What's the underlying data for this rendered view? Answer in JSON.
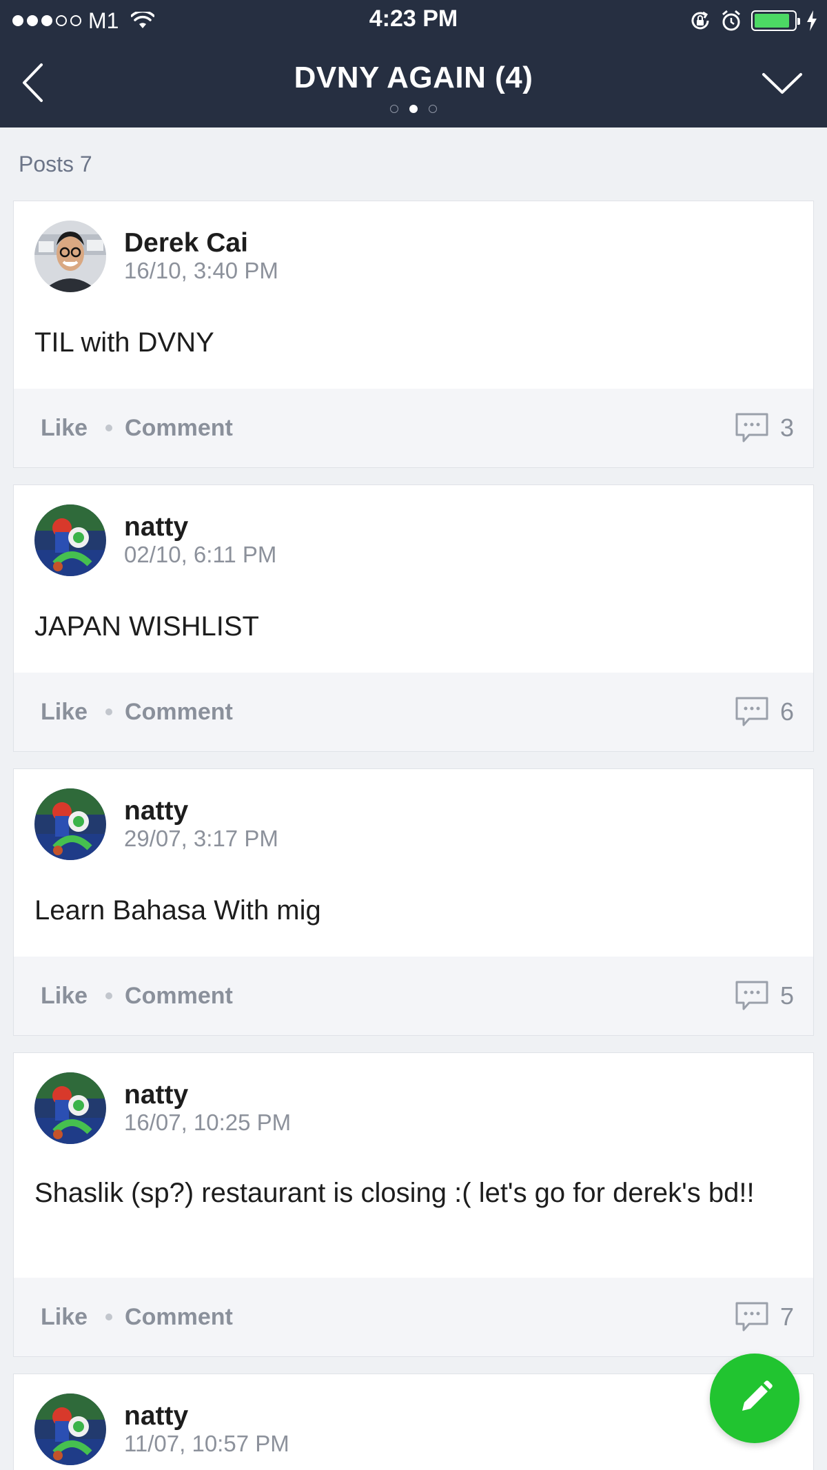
{
  "status_bar": {
    "carrier": "M1",
    "time": "4:23 PM",
    "signal_filled": 3,
    "signal_total": 5,
    "battery_level": 0.9,
    "battery_color": "#4cd964"
  },
  "nav": {
    "title": "DVNY AGAIN (4)",
    "back_icon": "chevron-left-icon",
    "menu_icon": "chevron-down-icon",
    "page_dots_total": 3,
    "page_dots_active": 2
  },
  "posts_count_label": "Posts 7",
  "like_label": "Like",
  "comment_label": "Comment",
  "posts": [
    {
      "author": "Derek Cai",
      "time": "16/10, 3:40 PM",
      "text": "TIL with DVNY",
      "comments": "3"
    },
    {
      "author": "natty",
      "time": "02/10, 6:11 PM",
      "text": "JAPAN WISHLIST",
      "comments": "6"
    },
    {
      "author": "natty",
      "time": "29/07, 3:17 PM",
      "text": "Learn Bahasa With mig",
      "comments": "5"
    },
    {
      "author": "natty",
      "time": "16/07, 10:25 PM",
      "text": "Shaslik (sp?) restaurant is closing :( let's go for derek's bd!!",
      "comments": "7"
    },
    {
      "author": "natty",
      "time": "11/07, 10:57 PM",
      "text": "",
      "comments": ""
    }
  ],
  "fab": {
    "icon": "pencil-icon",
    "color": "#21c430"
  }
}
